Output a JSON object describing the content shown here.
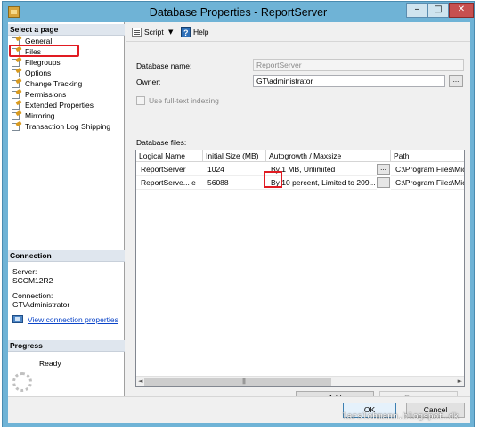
{
  "window": {
    "title": "Database Properties - ReportServer",
    "min_glyph": "–",
    "max_glyph": "□",
    "close_glyph": "✕"
  },
  "left": {
    "select_page_header": "Select a page",
    "pages": [
      {
        "label": "General"
      },
      {
        "label": "Files"
      },
      {
        "label": "Filegroups"
      },
      {
        "label": "Options"
      },
      {
        "label": "Change Tracking"
      },
      {
        "label": "Permissions"
      },
      {
        "label": "Extended Properties"
      },
      {
        "label": "Mirroring"
      },
      {
        "label": "Transaction Log Shipping"
      }
    ],
    "selected_page": "Files",
    "connection_header": "Connection",
    "server_label": "Server:",
    "server_value": "SCCM12R2",
    "connection_label": "Connection:",
    "connection_value": "GT\\Administrator",
    "view_connection_link": "View connection properties",
    "progress_header": "Progress",
    "progress_status": "Ready"
  },
  "toolbar": {
    "script_label": "Script",
    "script_dropdown_glyph": "▼",
    "help_label": "Help"
  },
  "files_page": {
    "database_name_label": "Database name:",
    "database_name_value": "ReportServer",
    "owner_label": "Owner:",
    "owner_value": "GT\\administrator",
    "owner_browse_label": "...",
    "fulltext_label": "Use full-text indexing",
    "fulltext_checked": false,
    "database_files_label": "Database files:",
    "columns": [
      "Logical Name",
      "Initial Size (MB)",
      "Autogrowth / Maxsize",
      "Path"
    ],
    "rows": [
      {
        "logical_name": "ReportServer",
        "initial_size": "1024",
        "autogrowth": "By 1 MB, Unlimited",
        "button": "...",
        "path": "C:\\Program Files\\Mic"
      },
      {
        "logical_name": "ReportServe... e",
        "initial_size": "56088",
        "autogrowth": "By 10 percent, Limited to 209...",
        "button": "...",
        "path": "C:\\Program Files\\Mic"
      }
    ],
    "scroll_left_glyph": "◄",
    "scroll_right_glyph": "►",
    "scroll_grip": "|||",
    "add_label": "Add",
    "remove_label": "Remove"
  },
  "footer": {
    "ok_label": "OK",
    "cancel_label": "Cancel"
  },
  "watermark": "larslohmann.blogspot.dk"
}
